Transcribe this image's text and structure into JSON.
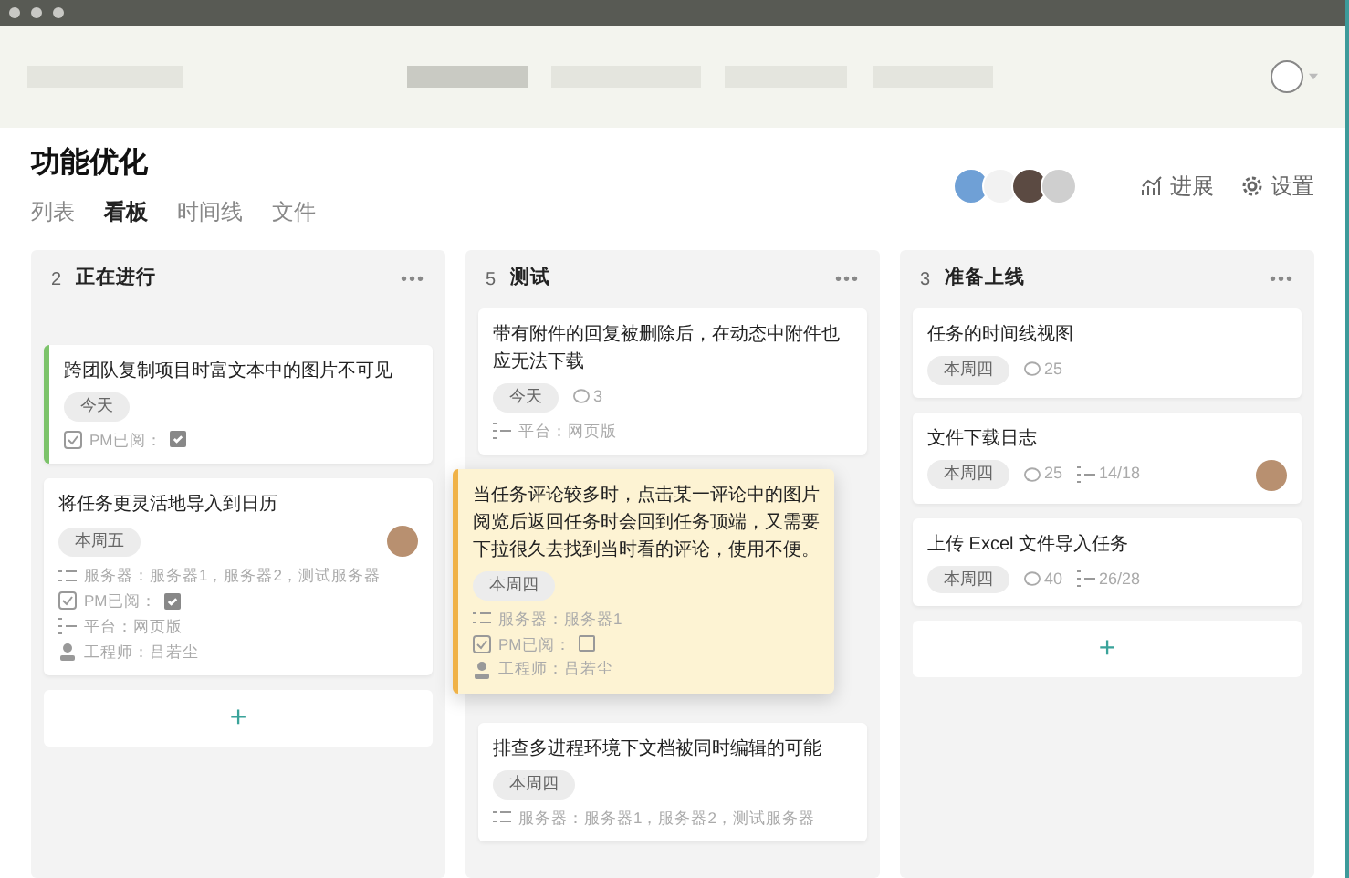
{
  "project": {
    "title": "功能优化",
    "views": [
      {
        "label": "列表",
        "selected": false
      },
      {
        "label": "看板",
        "selected": true
      },
      {
        "label": "时间线",
        "selected": false
      },
      {
        "label": "文件",
        "selected": false
      }
    ],
    "actions": [
      {
        "kind": "progress",
        "label": "进展"
      },
      {
        "kind": "settings",
        "label": "设置"
      }
    ]
  },
  "columns": [
    {
      "count": "2",
      "title": "正在进行",
      "menu": "•••",
      "add": "+",
      "cards": [
        {
          "title": "跨团队复制项目时富文本中的图片不可见",
          "color": "#7cc36a",
          "dragging": false,
          "due": "今天",
          "avatar": false,
          "props": [
            {
              "kind": "check",
              "label": "PM已阅：",
              "checked": true
            }
          ]
        },
        {
          "title": "将任务更灵活地导入到日历",
          "dragging": false,
          "due": "本周五",
          "avatar": true,
          "props": [
            {
              "kind": "list",
              "label": "服务器：服务器1，服务器2，测试服务器"
            },
            {
              "kind": "check",
              "label": "PM已阅：",
              "checked": true
            },
            {
              "kind": "platform",
              "label": "平台：网页版"
            },
            {
              "kind": "person",
              "label": "工程师：吕若尘"
            }
          ]
        }
      ]
    },
    {
      "count": "5",
      "title": "测试",
      "menu": "•••",
      "cards": [
        {
          "title": "带有附件的回复被删除后，在动态中附件也应无法下载",
          "dragging": false,
          "due": "今天",
          "comments": "3",
          "avatar": false,
          "props": [
            {
              "kind": "platform",
              "label": "平台：网页版"
            }
          ]
        },
        {
          "title": "当任务评论较多时，点击某一评论中的图片阅览后返回任务时会回到任务顶端，又需要下拉很久去找到当时看的评论，使用不便。",
          "color": "#f0b247",
          "dragging": true,
          "due": "本周四",
          "avatar": false,
          "props": [
            {
              "kind": "list",
              "label": "服务器：服务器1"
            },
            {
              "kind": "check",
              "label": "PM已阅：",
              "checked": false
            },
            {
              "kind": "person",
              "label": "工程师：吕若尘"
            }
          ]
        },
        {
          "title": "排查多进程环境下文档被同时编辑的可能",
          "dragging": false,
          "due": "本周四",
          "avatar": false,
          "props": [
            {
              "kind": "list",
              "label": "服务器：服务器1，服务器2，测试服务器"
            }
          ]
        }
      ]
    },
    {
      "count": "3",
      "title": "准备上线",
      "menu": "•••",
      "add": "+",
      "cards": [
        {
          "title": "任务的时间线视图",
          "dragging": false,
          "due": "本周四",
          "comments": "25",
          "avatar": false
        },
        {
          "title": "文件下载日志",
          "dragging": false,
          "due": "本周四",
          "comments": "25",
          "subtasks": "14/18",
          "avatar": true
        },
        {
          "title": "上传 Excel 文件导入任务",
          "dragging": false,
          "due": "本周四",
          "comments": "40",
          "subtasks": "26/28",
          "avatar": false
        }
      ]
    }
  ]
}
